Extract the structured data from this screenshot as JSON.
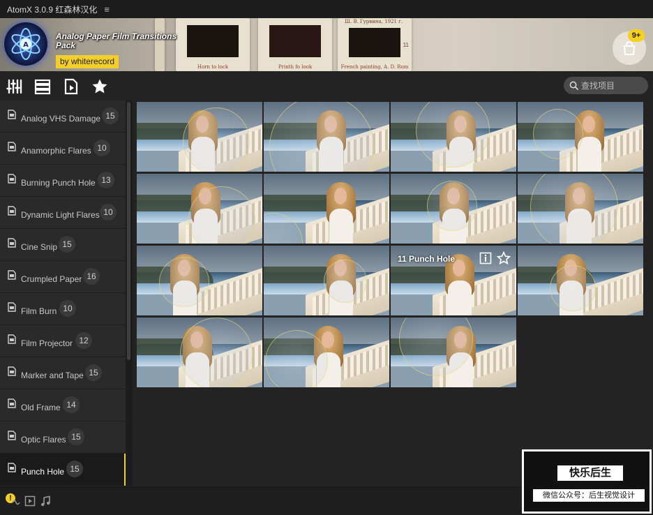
{
  "titlebar": {
    "app_title": "AtomX 3.0.9 红森林汉化",
    "menu_glyph": "≡"
  },
  "banner": {
    "pack_title": "Analog Paper Film Transitions Pack",
    "author": "by whiterecord",
    "cart_badge": "9+",
    "slides": [
      {
        "caption": ""
      },
      {
        "caption": "Horn to lock"
      },
      {
        "caption": "Printh fo look"
      },
      {
        "caption": ""
      },
      {
        "caption": "French painting, A. D. Rom"
      }
    ],
    "slide_tags": [
      "Ш. В. Гурвина, 1921 г.",
      "11"
    ]
  },
  "toolbar": {
    "icons": [
      "mixer-icon",
      "list-view-icon",
      "preview-icon",
      "favorites-icon"
    ],
    "search_placeholder": "查找项目"
  },
  "sidebar": {
    "categories": [
      {
        "label": "Analog VHS Damage",
        "count": "15"
      },
      {
        "label": "Anamorphic Flares",
        "count": "10"
      },
      {
        "label": "Burning Punch Hole",
        "count": "13"
      },
      {
        "label": "Dynamic Light Flares",
        "count": "10"
      },
      {
        "label": "Cine Snip",
        "count": "15"
      },
      {
        "label": "Crumpled Paper",
        "count": "16"
      },
      {
        "label": "Film Burn",
        "count": "10"
      },
      {
        "label": "Film Projector",
        "count": "12"
      },
      {
        "label": "Marker and Tape",
        "count": "15"
      },
      {
        "label": "Old Frame",
        "count": "14"
      },
      {
        "label": "Optic Flares",
        "count": "15"
      },
      {
        "label": "Punch Hole",
        "count": "15"
      }
    ],
    "active_index": 11
  },
  "grid": {
    "hover_label": "11 Punch Hole",
    "hover_info_icon": "info-icon",
    "hover_star_icon": "star-icon",
    "total_items": 15
  },
  "bottombar": {
    "warning_glyph": "!"
  },
  "watermark": {
    "title": "快乐后生",
    "subtitle": "微信公众号：后生视觉设计"
  },
  "colors": {
    "accent": "#f4cf2a",
    "background": "#232323",
    "sidebar": "#2a2a2a",
    "search_bg": "#4a4a4a"
  }
}
